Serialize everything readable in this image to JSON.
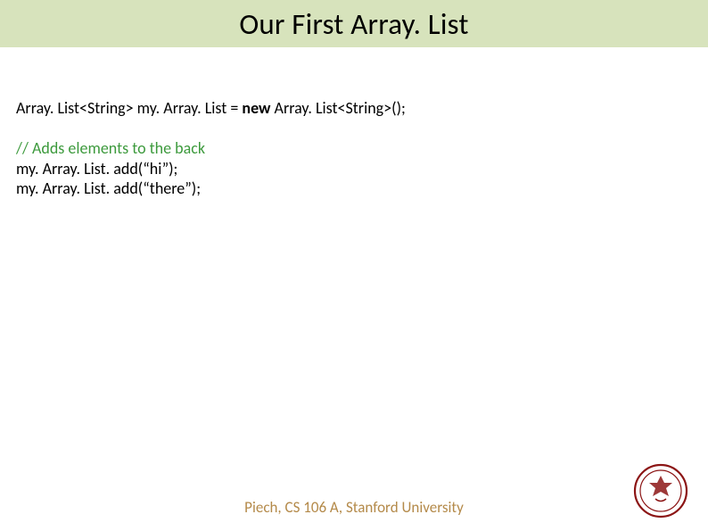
{
  "title": "Our First Array. List",
  "code": {
    "line1_pre": "Array. List<String> my. Array. List = ",
    "line1_kw": "new",
    "line1_post": " Array. List<String>();",
    "comment": "// Adds elements to the back",
    "line3": "my. Array. List. add(“hi”);",
    "line4": "my. Array. List. add(“there”);"
  },
  "footer": "Piech, CS 106 A, Stanford University",
  "seal_alt": "Stanford University Seal"
}
